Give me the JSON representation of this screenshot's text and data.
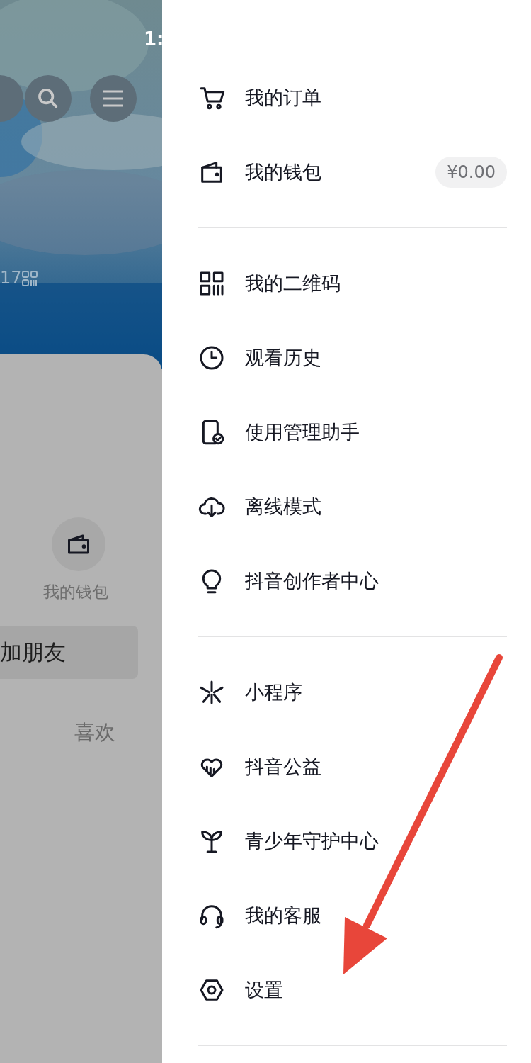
{
  "background_page": {
    "status_time": "1:",
    "count_partial": "17",
    "wallet_label": "我的钱包",
    "add_friends_button": "加朋友",
    "likes_tab": "喜欢"
  },
  "drawer": {
    "groups": [
      {
        "items": [
          {
            "kind": "cart",
            "label": "我的订单"
          },
          {
            "kind": "wallet",
            "label": "我的钱包",
            "badge": "¥0.00"
          }
        ]
      },
      {
        "items": [
          {
            "kind": "qrcode",
            "label": "我的二维码"
          },
          {
            "kind": "clock",
            "label": "观看历史"
          },
          {
            "kind": "phone",
            "label": "使用管理助手"
          },
          {
            "kind": "cloud",
            "label": "离线模式"
          },
          {
            "kind": "bulb",
            "label": "抖音创作者中心"
          }
        ]
      },
      {
        "items": [
          {
            "kind": "spark",
            "label": "小程序"
          },
          {
            "kind": "heart",
            "label": "抖音公益"
          },
          {
            "kind": "sprout",
            "label": "青少年守护中心"
          },
          {
            "kind": "headset",
            "label": "我的客服"
          },
          {
            "kind": "hexagon",
            "label": "设置"
          }
        ]
      }
    ]
  }
}
